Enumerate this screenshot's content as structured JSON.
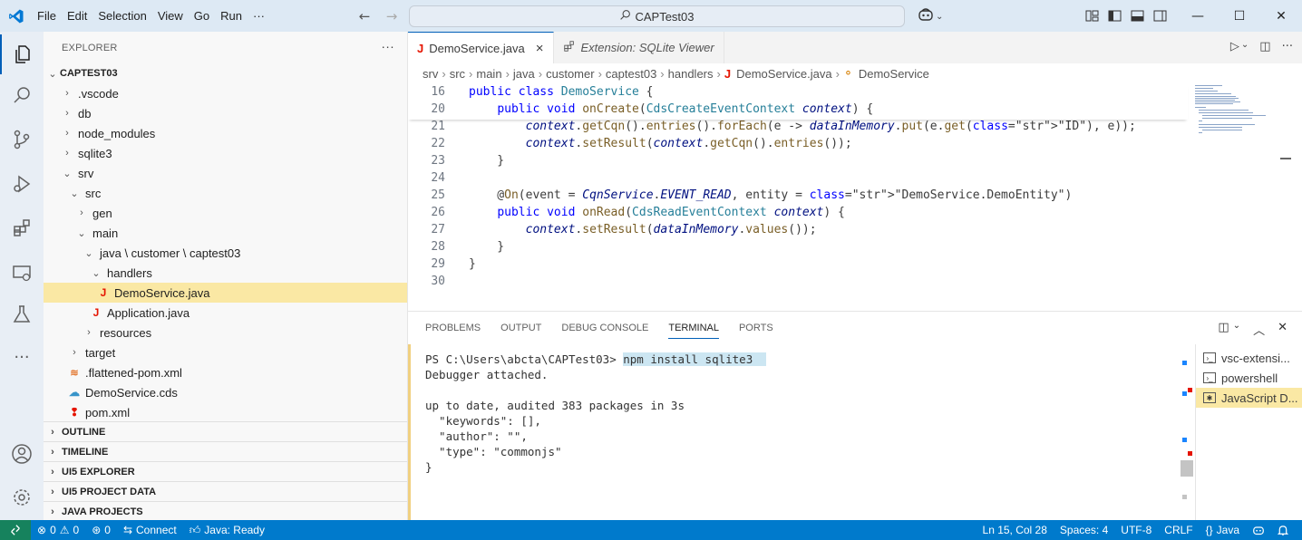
{
  "titlebar": {
    "menu": [
      "File",
      "Edit",
      "Selection",
      "View",
      "Go",
      "Run",
      "···"
    ],
    "search_text": "CAPTest03"
  },
  "sidebar": {
    "title": "EXPLORER",
    "more": "···",
    "project": "CAPTEST03",
    "tree": [
      {
        "label": ".vscode",
        "chev": "›",
        "indent": 0
      },
      {
        "label": "db",
        "chev": "›",
        "indent": 0
      },
      {
        "label": "node_modules",
        "chev": "›",
        "indent": 0
      },
      {
        "label": "sqlite3",
        "chev": "›",
        "indent": 0
      },
      {
        "label": "srv",
        "chev": "⌄",
        "indent": 0
      },
      {
        "label": "src",
        "chev": "⌄",
        "indent": 1
      },
      {
        "label": "gen",
        "chev": "›",
        "indent": 2
      },
      {
        "label": "main",
        "chev": "⌄",
        "indent": 2
      },
      {
        "label": "java \\ customer \\ captest03",
        "chev": "⌄",
        "indent": 3
      },
      {
        "label": "handlers",
        "chev": "⌄",
        "indent": 4
      },
      {
        "label": "DemoService.java",
        "icon": "J",
        "indent": 5,
        "selected": true
      },
      {
        "label": "Application.java",
        "icon": "J",
        "indent": 4
      },
      {
        "label": "resources",
        "chev": "›",
        "indent": 3
      },
      {
        "label": "target",
        "chev": "›",
        "indent": 1
      },
      {
        "label": ".flattened-pom.xml",
        "icon": "rss",
        "indent": 1
      },
      {
        "label": "DemoService.cds",
        "icon": "cloud",
        "indent": 1
      },
      {
        "label": "pom.xml",
        "icon": "pin",
        "indent": 1
      }
    ],
    "sections": [
      "OUTLINE",
      "TIMELINE",
      "UI5 EXPLORER",
      "UI5 PROJECT DATA",
      "JAVA PROJECTS"
    ]
  },
  "tabs": [
    {
      "label": "DemoService.java",
      "active": true,
      "close": "×"
    },
    {
      "label": "Extension: SQLite Viewer",
      "active": false
    }
  ],
  "breadcrumb": [
    "srv",
    "src",
    "main",
    "java",
    "customer",
    "captest03",
    "handlers",
    "DemoService.java",
    "DemoService"
  ],
  "editor": {
    "sticky": [
      {
        "ln": "16",
        "code": "public class DemoService {"
      },
      {
        "ln": "20",
        "code": "    public void onCreate(CdsCreateEventContext context) {"
      }
    ],
    "lines": [
      {
        "ln": "21",
        "code": "        context.getCqn().entries().forEach(e -> dataInMemory.put(e.get(\"ID\"), e));"
      },
      {
        "ln": "22",
        "code": "        context.setResult(context.getCqn().entries());"
      },
      {
        "ln": "23",
        "code": "    }"
      },
      {
        "ln": "24",
        "code": ""
      },
      {
        "ln": "25",
        "code": "    @On(event = CqnService.EVENT_READ, entity = \"DemoService.DemoEntity\")"
      },
      {
        "ln": "26",
        "code": "    public void onRead(CdsReadEventContext context) {"
      },
      {
        "ln": "27",
        "code": "        context.setResult(dataInMemory.values());"
      },
      {
        "ln": "28",
        "code": "    }"
      },
      {
        "ln": "29",
        "code": "}"
      },
      {
        "ln": "30",
        "code": ""
      }
    ]
  },
  "panel": {
    "tabs": [
      "PROBLEMS",
      "OUTPUT",
      "DEBUG CONSOLE",
      "TERMINAL",
      "PORTS"
    ],
    "active_tab": "TERMINAL",
    "prompt": "PS C:\\Users\\abcta\\CAPTest03> ",
    "command": "npm install sqlite3",
    "output": [
      "Debugger attached.",
      "",
      "up to date, audited 383 packages in 3s",
      "  \"keywords\": [],",
      "  \"author\": \"\",",
      "  \"type\": \"commonjs\"",
      "}"
    ],
    "terminals": [
      {
        "label": "vsc-extensi...",
        "icon": "terminal-icon"
      },
      {
        "label": "powershell",
        "icon": "terminal-icon"
      },
      {
        "label": "JavaScript D...",
        "icon": "debug-icon",
        "active": true
      }
    ]
  },
  "statusbar": {
    "errors": "0",
    "warnings": "0",
    "ports": "0",
    "connect": "Connect",
    "java_status": "Java: Ready",
    "position": "Ln 15, Col 28",
    "spaces": "Spaces: 4",
    "encoding": "UTF-8",
    "eol": "CRLF",
    "language": "Java"
  },
  "colors": {
    "accent": "#005fb8",
    "statusbar": "#007acc",
    "selection": "#fae8a4",
    "java_icon": "#e51400"
  }
}
